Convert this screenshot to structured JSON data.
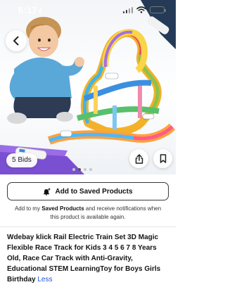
{
  "status_bar": {
    "time": "6:17",
    "icons": [
      "moon-icon",
      "signal-icon",
      "wifi-icon",
      "battery-icon"
    ]
  },
  "product_image": {
    "bids_badge": "5 Bids",
    "dots_total": 4,
    "dots_active_index": 1
  },
  "actions": {
    "back_icon": "chevron-left-icon",
    "share_icon": "share-icon",
    "save_icon": "bookmark-icon"
  },
  "saved": {
    "button_label": "Add to Saved Products",
    "note_prefix": "Add to my ",
    "note_bold": "Saved Products",
    "note_suffix": " and receive notifications when this product is available again."
  },
  "product": {
    "title": "Wdebay klick Rail Electric Train Set 3D Magic Flexible Race Track for Kids 3 4 5 6 7 8 Years Old, Race Car Track with Anti-Gravity, Educational STEM LearningToy for Boys Girls Birthday",
    "less_link": "Less"
  },
  "colors": {
    "accent_link": "#1a56db",
    "button_border": "#3a3a3a"
  }
}
